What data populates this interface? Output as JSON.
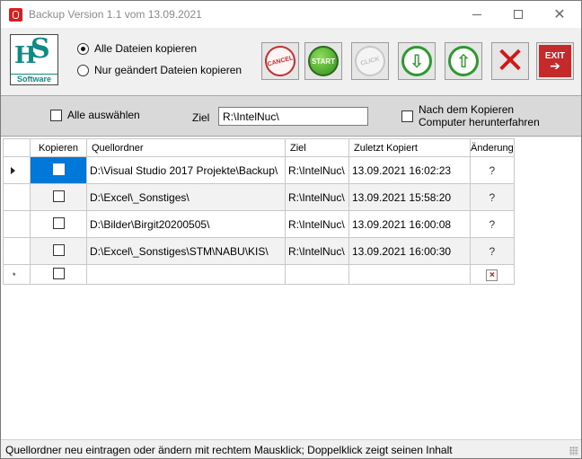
{
  "window": {
    "title": "Backup Version 1.1 vom 13.09.2021"
  },
  "logo": {
    "letters_left": "H",
    "letters_right": "S",
    "footer": "Software"
  },
  "copy_mode": {
    "option_all": "Alle Dateien kopieren",
    "option_changed": "Nur geändert Dateien kopieren",
    "selected": "option_all"
  },
  "toolbar": {
    "cancel_label": "CANCEL",
    "start_label": "START",
    "click_label": "CLICK",
    "exit_label": "EXIT"
  },
  "options": {
    "select_all_label": "Alle auswählen",
    "select_all_checked": false,
    "ziel_label": "Ziel",
    "ziel_value": "R:\\IntelNuc\\",
    "shutdown_line1": "Nach dem Kopieren",
    "shutdown_line2": "Computer herunterfahren",
    "shutdown_checked": false
  },
  "grid": {
    "columns": [
      "Kopieren",
      "Quellordner",
      "Ziel",
      "Zuletzt Kopiert",
      "Änderung"
    ],
    "rows": [
      {
        "quellordner": "D:\\Visual Studio 2017 Projekte\\Backup\\",
        "ziel": "R:\\IntelNuc\\",
        "zuletzt": "13.09.2021 16:02:23",
        "aenderung": "?"
      },
      {
        "quellordner": "D:\\Excel\\_Sonstiges\\",
        "ziel": "R:\\IntelNuc\\",
        "zuletzt": "13.09.2021 15:58:20",
        "aenderung": "?"
      },
      {
        "quellordner": "D:\\Bilder\\Birgit20200505\\",
        "ziel": "R:\\IntelNuc\\",
        "zuletzt": "13.09.2021 16:00:08",
        "aenderung": "?"
      },
      {
        "quellordner": "D:\\Excel\\_Sonstiges\\STM\\NABU\\KIS\\",
        "ziel": "R:\\IntelNuc\\",
        "zuletzt": "13.09.2021 16:00:30",
        "aenderung": "?"
      }
    ],
    "new_row_marker": "*"
  },
  "status": {
    "text": "Quellordner neu eintragen oder ändern mit rechtem Mausklick; Doppelklick zeigt seinen Inhalt"
  },
  "colors": {
    "selection": "#0078d7",
    "logo_teal": "#0f8a84",
    "exit_red": "#c42a2a"
  }
}
